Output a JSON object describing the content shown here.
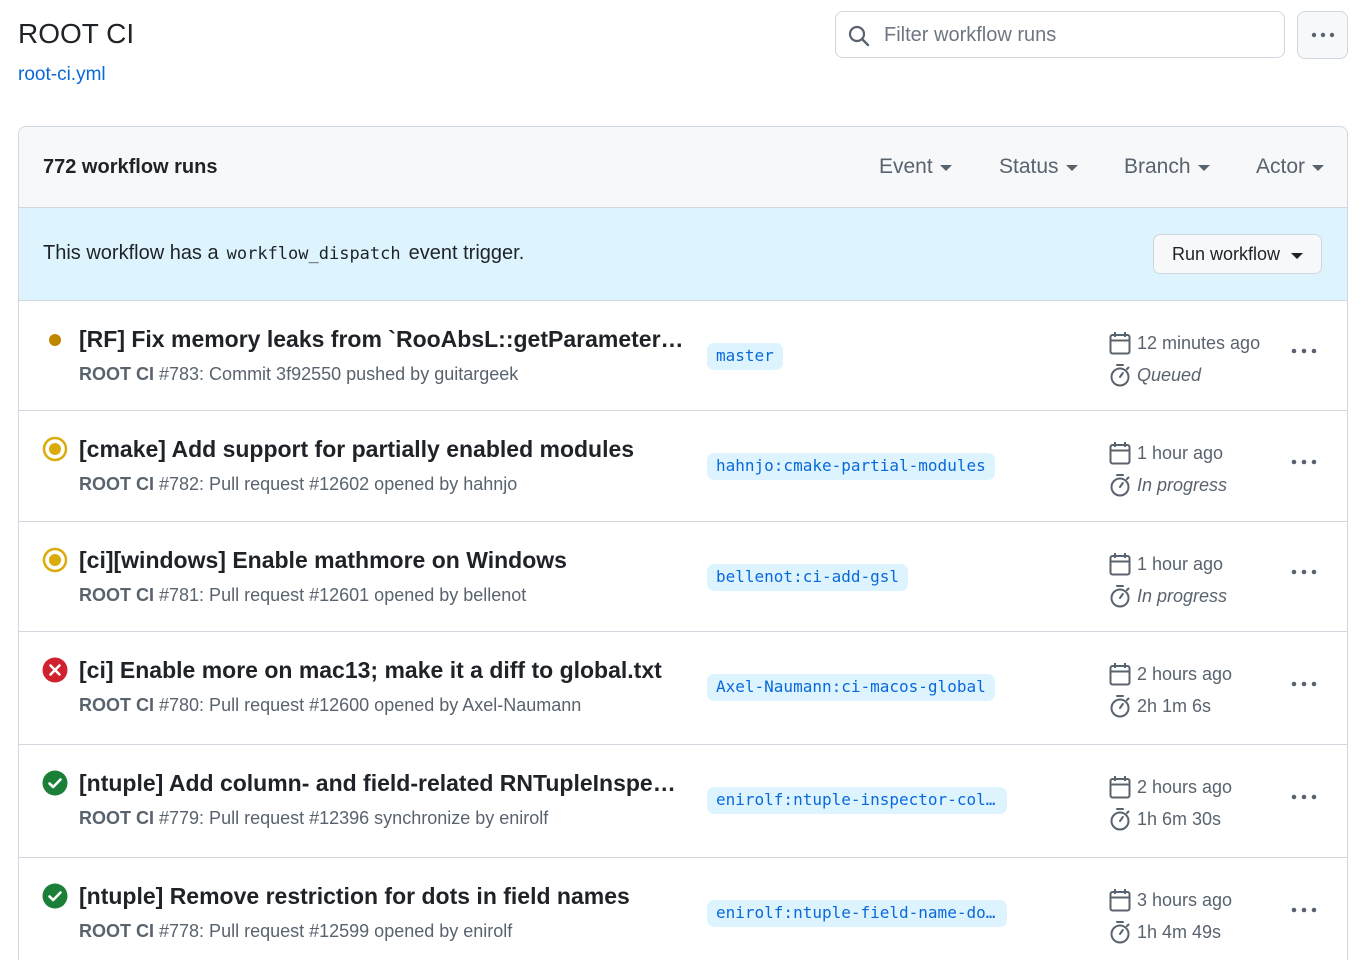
{
  "header": {
    "title": "ROOT CI",
    "workflow_file": "root-ci.yml",
    "search_placeholder": "Filter workflow runs"
  },
  "box": {
    "runs_count": "772 workflow runs",
    "filters": [
      "Event",
      "Status",
      "Branch",
      "Actor"
    ]
  },
  "dispatch": {
    "text_before": "This workflow has a",
    "code": "workflow_dispatch",
    "text_after": "event trigger.",
    "button_label": "Run workflow"
  },
  "colors": {
    "queued": "#bf8700",
    "in_progress": "#dbab0a",
    "failure": "#cf222e",
    "success": "#1a7f37",
    "link": "#0969da"
  },
  "runs": [
    {
      "status": "queued",
      "status_icon": "dot-icon",
      "title": "[RF] Fix memory leaks from `RooAbsL::getParameters()`",
      "workflow": "ROOT CI",
      "meta": "#783: Commit 3f92550 pushed by guitargeek",
      "branch": "master",
      "time": "12 minutes ago",
      "duration": "Queued",
      "duration_italic": true
    },
    {
      "status": "in_progress",
      "status_icon": "in-progress-icon",
      "title": "[cmake] Add support for partially enabled modules",
      "workflow": "ROOT CI",
      "meta": "#782: Pull request #12602 opened by hahnjo",
      "branch": "hahnjo:cmake-partial-modules",
      "time": "1 hour ago",
      "duration": "In progress",
      "duration_italic": true
    },
    {
      "status": "in_progress",
      "status_icon": "in-progress-icon",
      "title": "[ci][windows] Enable mathmore on Windows",
      "workflow": "ROOT CI",
      "meta": "#781: Pull request #12601 opened by bellenot",
      "branch": "bellenot:ci-add-gsl",
      "time": "1 hour ago",
      "duration": "In progress",
      "duration_italic": true
    },
    {
      "status": "failure",
      "status_icon": "x-circle-icon",
      "title": "[ci] Enable more on mac13; make it a diff to global.txt",
      "workflow": "ROOT CI",
      "meta": "#780: Pull request #12600 opened by Axel-Naumann",
      "branch": "Axel-Naumann:ci-macos-global",
      "time": "2 hours ago",
      "duration": "2h 1m 6s",
      "duration_italic": false
    },
    {
      "status": "success",
      "status_icon": "check-circle-icon",
      "title": "[ntuple] Add column- and field-related RNTupleInspector methods",
      "workflow": "ROOT CI",
      "meta": "#779: Pull request #12396 synchronize by enirolf",
      "branch": "enirolf:ntuple-inspector-columns",
      "time": "2 hours ago",
      "duration": "1h 6m 30s",
      "duration_italic": false
    },
    {
      "status": "success",
      "status_icon": "check-circle-icon",
      "title": "[ntuple] Remove restriction for dots in field names",
      "workflow": "ROOT CI",
      "meta": "#778: Pull request #12599 opened by enirolf",
      "branch": "enirolf:ntuple-field-name-dots",
      "time": "3 hours ago",
      "duration": "1h 4m 49s",
      "duration_italic": false
    }
  ]
}
